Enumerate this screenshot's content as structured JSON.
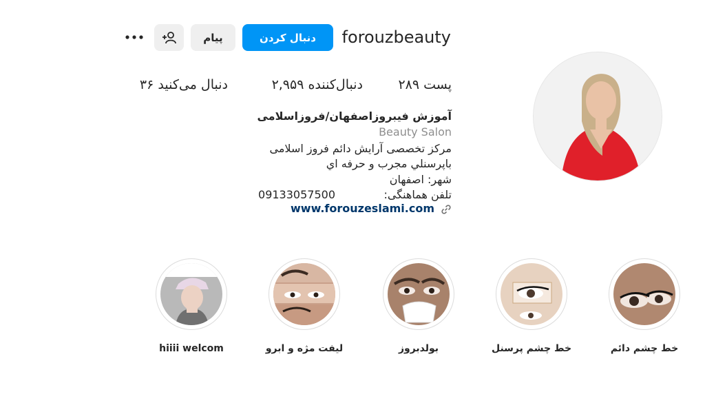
{
  "profile": {
    "username": "forouzbeauty",
    "follow_label": "دنبال کردن",
    "message_label": "پیام",
    "stats": {
      "posts": "۲۸۹ پست",
      "followers": "۲,۹۵۹ دنبال‌کننده",
      "following": "۳۶ دنبال می‌کنید"
    },
    "full_name": "آموزش فیبروزاصفهان/فروزاسلامی",
    "category": "Beauty Salon",
    "bio_lines": [
      "مرکز تخصصی آرایش دائم فروز اسلامی",
      "باپرسنلي مجرب و حرفه اي",
      "شهر: اصفهان",
      "تلفن هماهنگی:"
    ],
    "phone": "09133057500",
    "website": "www.forouzeslami.com"
  },
  "highlights": [
    {
      "label": "خط چشم دائم"
    },
    {
      "label": "خط چشم پرسنل"
    },
    {
      "label": "بولدبروز"
    },
    {
      "label": "لیفت مژه و ابرو"
    },
    {
      "label": "hiiii welcom"
    }
  ],
  "colors": {
    "primary_button": "#0095f6",
    "secondary_button": "#efefef",
    "link": "#00376b",
    "muted": "#8e8e8e"
  }
}
